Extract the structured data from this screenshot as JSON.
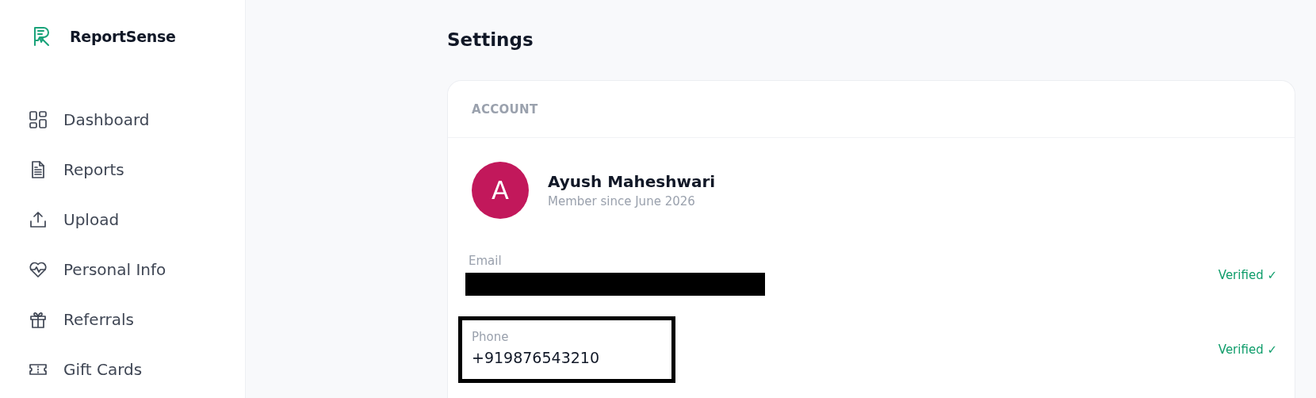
{
  "brand": {
    "name": "ReportSense"
  },
  "sidebar": {
    "items": [
      {
        "label": "Dashboard",
        "kind": "grid"
      },
      {
        "label": "Reports",
        "kind": "document"
      },
      {
        "label": "Upload",
        "kind": "upload"
      },
      {
        "label": "Personal Info",
        "kind": "heart"
      },
      {
        "label": "Referrals",
        "kind": "gift"
      },
      {
        "label": "Gift Cards",
        "kind": "ticket"
      }
    ]
  },
  "page": {
    "title": "Settings"
  },
  "account": {
    "heading": "ACCOUNT",
    "avatar_initial": "A",
    "name": "Ayush Maheshwari",
    "member_since": "Member since June 2026",
    "fields": [
      {
        "label": "Email",
        "redacted": true,
        "status": "Verified ✓",
        "highlighted": false
      },
      {
        "label": "Phone",
        "value": "+919876543210",
        "redacted": false,
        "status": "Verified ✓",
        "highlighted": true
      }
    ]
  }
}
